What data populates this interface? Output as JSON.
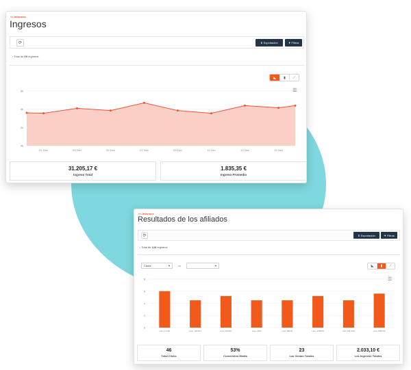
{
  "income": {
    "breadcrumb": "<< Informes",
    "title": "Ingresos",
    "refresh_icon": "refresh-icon",
    "export_label": "Exportación",
    "filter_label": "Filtros",
    "records_prefix": "Total de",
    "records_count": "69",
    "records_suffix": "registros",
    "stats": [
      {
        "value": "31.205,17 €",
        "label": "Ingreso Total"
      },
      {
        "value": "1.835,35 €",
        "label": "Ingreso Promedio"
      }
    ]
  },
  "affiliates": {
    "breadcrumb": "<< Informes",
    "title": "Resultados de los afiliados",
    "refresh_icon": "refresh-icon",
    "export_label": "Exportación",
    "filter_label": "Filtros",
    "records_prefix": "Total de",
    "records_count": "126",
    "records_suffix": "registros",
    "metric_select": "Clicks",
    "compare_label": "vs",
    "compare_select": "",
    "stats": [
      {
        "value": "46",
        "label": "Total Clicks"
      },
      {
        "value": "53%",
        "label": "Conversión Media"
      },
      {
        "value": "23",
        "label": "Las Ventas Totales"
      },
      {
        "value": "2.033,10 €",
        "label": "Los Ingresos Totales"
      }
    ]
  },
  "colors": {
    "accent": "#f25a1c",
    "dark_button": "#243447",
    "line": "#e8543a",
    "area": "#f8c7bc",
    "teal": "#7fd8df"
  },
  "chart_data": [
    {
      "type": "area",
      "y_ticks": [
        "6k",
        "4k",
        "2k",
        "0k"
      ],
      "ylim": [
        0,
        6000
      ],
      "x_ticks": [
        "01 Dec",
        "03 Dec",
        "05 Dec",
        "07 Dec",
        "09 Dec",
        "11 Dec",
        "13 Dec",
        "15 Dec"
      ],
      "x": [
        0,
        1,
        3,
        5,
        7,
        9,
        11,
        13,
        15,
        16
      ],
      "values": [
        3600,
        3550,
        4100,
        3850,
        4700,
        3850,
        3550,
        4400,
        4150,
        4400
      ],
      "legend": "none",
      "grid": true
    },
    {
      "type": "bar",
      "y_ticks": [
        "8",
        "6",
        "4",
        "2",
        "0"
      ],
      "ylim": [
        0,
        8
      ],
      "categories": [
        "User 1 Kidb",
        "User 126ZNA",
        "User 50A987",
        "User J263",
        "User 86F53",
        "User 12B878",
        "User M8 CD8",
        "User 86B755"
      ],
      "values": [
        6,
        4.5,
        5.2,
        4.5,
        4.5,
        5.2,
        4.5,
        5.6
      ],
      "legend": "none",
      "grid": true
    }
  ]
}
